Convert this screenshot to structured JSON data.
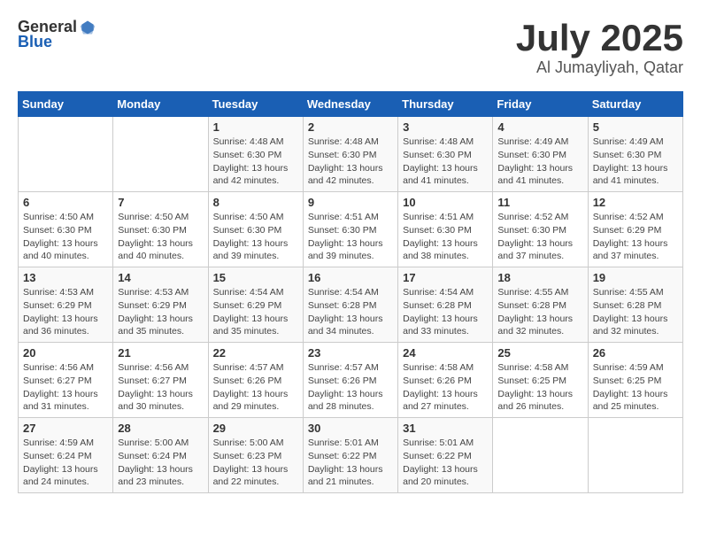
{
  "header": {
    "logo_general": "General",
    "logo_blue": "Blue",
    "month": "July 2025",
    "location": "Al Jumayliyah, Qatar"
  },
  "weekdays": [
    "Sunday",
    "Monday",
    "Tuesday",
    "Wednesday",
    "Thursday",
    "Friday",
    "Saturday"
  ],
  "weeks": [
    [
      {
        "day": "",
        "content": ""
      },
      {
        "day": "",
        "content": ""
      },
      {
        "day": "1",
        "content": "Sunrise: 4:48 AM\nSunset: 6:30 PM\nDaylight: 13 hours and 42 minutes."
      },
      {
        "day": "2",
        "content": "Sunrise: 4:48 AM\nSunset: 6:30 PM\nDaylight: 13 hours and 42 minutes."
      },
      {
        "day": "3",
        "content": "Sunrise: 4:48 AM\nSunset: 6:30 PM\nDaylight: 13 hours and 41 minutes."
      },
      {
        "day": "4",
        "content": "Sunrise: 4:49 AM\nSunset: 6:30 PM\nDaylight: 13 hours and 41 minutes."
      },
      {
        "day": "5",
        "content": "Sunrise: 4:49 AM\nSunset: 6:30 PM\nDaylight: 13 hours and 41 minutes."
      }
    ],
    [
      {
        "day": "6",
        "content": "Sunrise: 4:50 AM\nSunset: 6:30 PM\nDaylight: 13 hours and 40 minutes."
      },
      {
        "day": "7",
        "content": "Sunrise: 4:50 AM\nSunset: 6:30 PM\nDaylight: 13 hours and 40 minutes."
      },
      {
        "day": "8",
        "content": "Sunrise: 4:50 AM\nSunset: 6:30 PM\nDaylight: 13 hours and 39 minutes."
      },
      {
        "day": "9",
        "content": "Sunrise: 4:51 AM\nSunset: 6:30 PM\nDaylight: 13 hours and 39 minutes."
      },
      {
        "day": "10",
        "content": "Sunrise: 4:51 AM\nSunset: 6:30 PM\nDaylight: 13 hours and 38 minutes."
      },
      {
        "day": "11",
        "content": "Sunrise: 4:52 AM\nSunset: 6:30 PM\nDaylight: 13 hours and 37 minutes."
      },
      {
        "day": "12",
        "content": "Sunrise: 4:52 AM\nSunset: 6:29 PM\nDaylight: 13 hours and 37 minutes."
      }
    ],
    [
      {
        "day": "13",
        "content": "Sunrise: 4:53 AM\nSunset: 6:29 PM\nDaylight: 13 hours and 36 minutes."
      },
      {
        "day": "14",
        "content": "Sunrise: 4:53 AM\nSunset: 6:29 PM\nDaylight: 13 hours and 35 minutes."
      },
      {
        "day": "15",
        "content": "Sunrise: 4:54 AM\nSunset: 6:29 PM\nDaylight: 13 hours and 35 minutes."
      },
      {
        "day": "16",
        "content": "Sunrise: 4:54 AM\nSunset: 6:28 PM\nDaylight: 13 hours and 34 minutes."
      },
      {
        "day": "17",
        "content": "Sunrise: 4:54 AM\nSunset: 6:28 PM\nDaylight: 13 hours and 33 minutes."
      },
      {
        "day": "18",
        "content": "Sunrise: 4:55 AM\nSunset: 6:28 PM\nDaylight: 13 hours and 32 minutes."
      },
      {
        "day": "19",
        "content": "Sunrise: 4:55 AM\nSunset: 6:28 PM\nDaylight: 13 hours and 32 minutes."
      }
    ],
    [
      {
        "day": "20",
        "content": "Sunrise: 4:56 AM\nSunset: 6:27 PM\nDaylight: 13 hours and 31 minutes."
      },
      {
        "day": "21",
        "content": "Sunrise: 4:56 AM\nSunset: 6:27 PM\nDaylight: 13 hours and 30 minutes."
      },
      {
        "day": "22",
        "content": "Sunrise: 4:57 AM\nSunset: 6:26 PM\nDaylight: 13 hours and 29 minutes."
      },
      {
        "day": "23",
        "content": "Sunrise: 4:57 AM\nSunset: 6:26 PM\nDaylight: 13 hours and 28 minutes."
      },
      {
        "day": "24",
        "content": "Sunrise: 4:58 AM\nSunset: 6:26 PM\nDaylight: 13 hours and 27 minutes."
      },
      {
        "day": "25",
        "content": "Sunrise: 4:58 AM\nSunset: 6:25 PM\nDaylight: 13 hours and 26 minutes."
      },
      {
        "day": "26",
        "content": "Sunrise: 4:59 AM\nSunset: 6:25 PM\nDaylight: 13 hours and 25 minutes."
      }
    ],
    [
      {
        "day": "27",
        "content": "Sunrise: 4:59 AM\nSunset: 6:24 PM\nDaylight: 13 hours and 24 minutes."
      },
      {
        "day": "28",
        "content": "Sunrise: 5:00 AM\nSunset: 6:24 PM\nDaylight: 13 hours and 23 minutes."
      },
      {
        "day": "29",
        "content": "Sunrise: 5:00 AM\nSunset: 6:23 PM\nDaylight: 13 hours and 22 minutes."
      },
      {
        "day": "30",
        "content": "Sunrise: 5:01 AM\nSunset: 6:22 PM\nDaylight: 13 hours and 21 minutes."
      },
      {
        "day": "31",
        "content": "Sunrise: 5:01 AM\nSunset: 6:22 PM\nDaylight: 13 hours and 20 minutes."
      },
      {
        "day": "",
        "content": ""
      },
      {
        "day": "",
        "content": ""
      }
    ]
  ]
}
